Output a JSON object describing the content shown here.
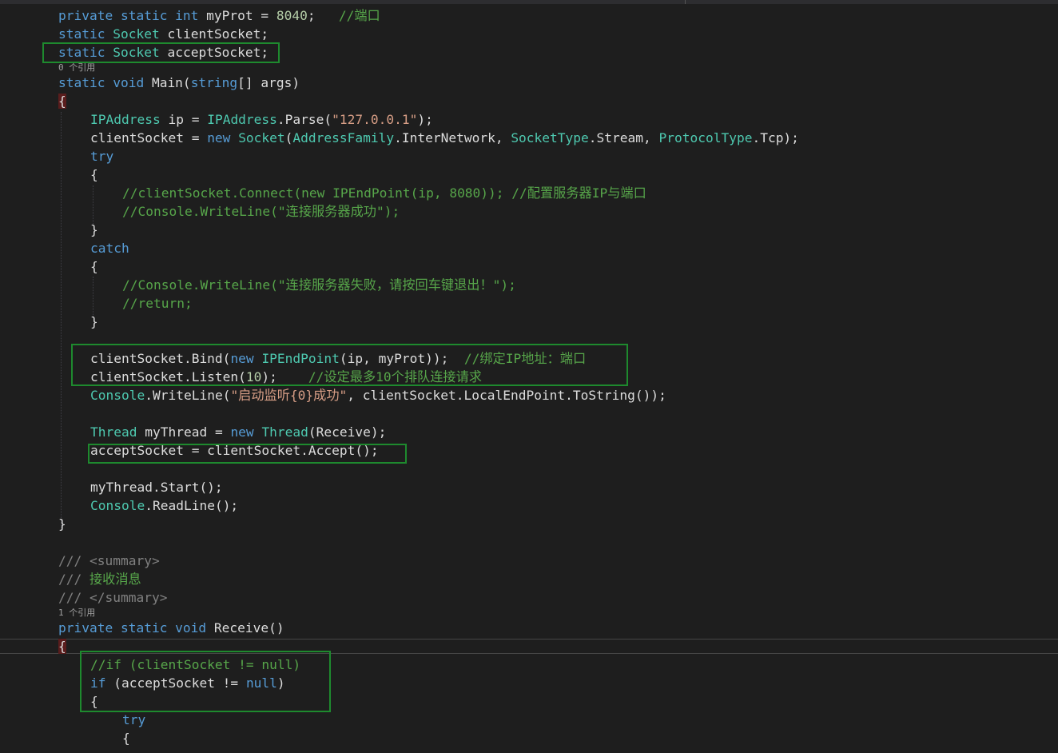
{
  "editor": {
    "lines": [
      "private static int myProt = 8040;   //端口",
      "static Socket clientSocket;",
      "static Socket acceptSocket;",
      "static void Main(string[] args)",
      "{",
      "IPAddress ip = IPAddress.Parse(\"127.0.0.1\");",
      "clientSocket = new Socket(AddressFamily.InterNetwork, SocketType.Stream, ProtocolType.Tcp);",
      "try",
      "{",
      "//clientSocket.Connect(new IPEndPoint(ip, 8080)); //配置服务器IP与端口",
      "//Console.WriteLine(\"连接服务器成功\");",
      "}",
      "catch",
      "{",
      "//Console.WriteLine(\"连接服务器失败，请按回车键退出！\");",
      "//return;",
      "}",
      "clientSocket.Bind(new IPEndPoint(ip, myProt));  //绑定IP地址：端口",
      "clientSocket.Listen(10);    //设定最多10个排队连接请求",
      "Console.WriteLine(\"启动监听{0}成功\", clientSocket.LocalEndPoint.ToString());",
      "Thread myThread = new Thread(Receive);",
      "acceptSocket = clientSocket.Accept();",
      "myThread.Start();",
      "Console.ReadLine();",
      "}",
      "/// <summary>",
      "/// 接收消息",
      "/// </summary>",
      "private static void Receive()",
      "{",
      "//if (clientSocket != null)",
      "if (acceptSocket != null)",
      "{",
      "try",
      "{"
    ],
    "codelens": [
      "0 个引用",
      "1 个引用"
    ]
  },
  "colors": {
    "keyword": "#569cd6",
    "type": "#4ec9b0",
    "string": "#d69d85",
    "number": "#b5cea8",
    "comment": "#57a64a",
    "highlight_box": "#1e8a2e"
  }
}
